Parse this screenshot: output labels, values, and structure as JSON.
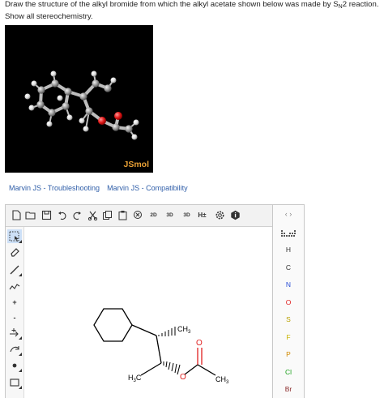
{
  "question": {
    "line1_pre": "Draw the structure of the alkyl bromide from which the alkyl acetate shown below was made by S",
    "line1_sub": "N",
    "line1_post": "2 reaction.",
    "line2": "Show all stereochemistry."
  },
  "jsmol": {
    "label": "JSmol"
  },
  "links": {
    "troubleshooting": "Marvin JS - Troubleshooting",
    "compatibility": "Marvin JS - Compatibility"
  },
  "toolbar": {
    "icons": [
      "new-document-icon",
      "open-icon",
      "save-icon",
      "undo-icon",
      "redo-icon",
      "cut-icon",
      "copy-icon",
      "paste-icon",
      "zoom-icon",
      "clean-2d-icon",
      "clean-3d-icon",
      "3d-view-icon",
      "hydrogen-icon",
      "settings-icon",
      "info-icon"
    ],
    "clean2d_label": "2D",
    "clean3d_label": "3D",
    "view3d_label": "3D",
    "hydrogen_label": "H±"
  },
  "elements": {
    "arrows": "‹ ›",
    "items": [
      {
        "symbol": "H",
        "color": "#333333"
      },
      {
        "symbol": "C",
        "color": "#333333"
      },
      {
        "symbol": "N",
        "color": "#2a4fd6"
      },
      {
        "symbol": "O",
        "color": "#e02020"
      },
      {
        "symbol": "S",
        "color": "#b8a000"
      },
      {
        "symbol": "F",
        "color": "#c8b400"
      },
      {
        "symbol": "P",
        "color": "#d08a00"
      },
      {
        "symbol": "Cl",
        "color": "#1aa01a"
      },
      {
        "symbol": "Br",
        "color": "#8a2a2a"
      }
    ]
  },
  "structure": {
    "ch3_top": "CH",
    "ch3_top_sub": "3",
    "h3c_pre": "H",
    "h3c_sub": "3",
    "h3c_post": "C",
    "oxygen_ester": "O",
    "oxygen_carbonyl": "O",
    "ch3_acetyl": "CH",
    "ch3_acetyl_sub": "3"
  },
  "colors": {
    "oxygen": "#e02020",
    "link": "#2e5da8",
    "jsmol_label": "#e8a035"
  }
}
